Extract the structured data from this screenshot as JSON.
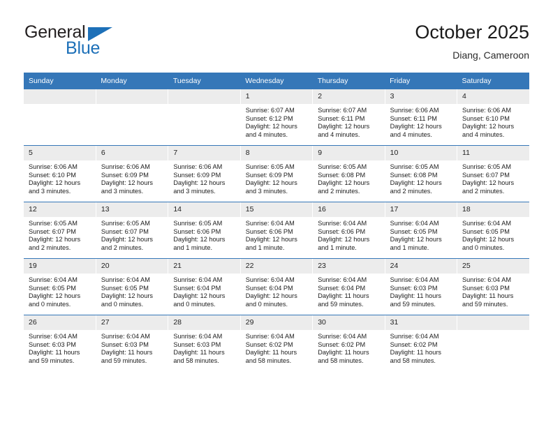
{
  "brand": {
    "name_top": "General",
    "name_bottom": "Blue",
    "triangle_color": "#1d70b8",
    "text_color": "#231f20"
  },
  "header": {
    "title": "October 2025",
    "subtitle": "Diang, Cameroon"
  },
  "theme": {
    "header_bg": "#3577b8",
    "daynum_bg": "#ececec",
    "grid_line": "#3577b8",
    "page_bg": "#ffffff"
  },
  "weekdays": [
    "Sunday",
    "Monday",
    "Tuesday",
    "Wednesday",
    "Thursday",
    "Friday",
    "Saturday"
  ],
  "weeks": [
    [
      {
        "day": "",
        "lines": []
      },
      {
        "day": "",
        "lines": []
      },
      {
        "day": "",
        "lines": []
      },
      {
        "day": "1",
        "lines": [
          "Sunrise: 6:07 AM",
          "Sunset: 6:12 PM",
          "Daylight: 12 hours",
          "and 4 minutes."
        ]
      },
      {
        "day": "2",
        "lines": [
          "Sunrise: 6:07 AM",
          "Sunset: 6:11 PM",
          "Daylight: 12 hours",
          "and 4 minutes."
        ]
      },
      {
        "day": "3",
        "lines": [
          "Sunrise: 6:06 AM",
          "Sunset: 6:11 PM",
          "Daylight: 12 hours",
          "and 4 minutes."
        ]
      },
      {
        "day": "4",
        "lines": [
          "Sunrise: 6:06 AM",
          "Sunset: 6:10 PM",
          "Daylight: 12 hours",
          "and 4 minutes."
        ]
      }
    ],
    [
      {
        "day": "5",
        "lines": [
          "Sunrise: 6:06 AM",
          "Sunset: 6:10 PM",
          "Daylight: 12 hours",
          "and 3 minutes."
        ]
      },
      {
        "day": "6",
        "lines": [
          "Sunrise: 6:06 AM",
          "Sunset: 6:09 PM",
          "Daylight: 12 hours",
          "and 3 minutes."
        ]
      },
      {
        "day": "7",
        "lines": [
          "Sunrise: 6:06 AM",
          "Sunset: 6:09 PM",
          "Daylight: 12 hours",
          "and 3 minutes."
        ]
      },
      {
        "day": "8",
        "lines": [
          "Sunrise: 6:05 AM",
          "Sunset: 6:09 PM",
          "Daylight: 12 hours",
          "and 3 minutes."
        ]
      },
      {
        "day": "9",
        "lines": [
          "Sunrise: 6:05 AM",
          "Sunset: 6:08 PM",
          "Daylight: 12 hours",
          "and 2 minutes."
        ]
      },
      {
        "day": "10",
        "lines": [
          "Sunrise: 6:05 AM",
          "Sunset: 6:08 PM",
          "Daylight: 12 hours",
          "and 2 minutes."
        ]
      },
      {
        "day": "11",
        "lines": [
          "Sunrise: 6:05 AM",
          "Sunset: 6:07 PM",
          "Daylight: 12 hours",
          "and 2 minutes."
        ]
      }
    ],
    [
      {
        "day": "12",
        "lines": [
          "Sunrise: 6:05 AM",
          "Sunset: 6:07 PM",
          "Daylight: 12 hours",
          "and 2 minutes."
        ]
      },
      {
        "day": "13",
        "lines": [
          "Sunrise: 6:05 AM",
          "Sunset: 6:07 PM",
          "Daylight: 12 hours",
          "and 2 minutes."
        ]
      },
      {
        "day": "14",
        "lines": [
          "Sunrise: 6:05 AM",
          "Sunset: 6:06 PM",
          "Daylight: 12 hours",
          "and 1 minute."
        ]
      },
      {
        "day": "15",
        "lines": [
          "Sunrise: 6:04 AM",
          "Sunset: 6:06 PM",
          "Daylight: 12 hours",
          "and 1 minute."
        ]
      },
      {
        "day": "16",
        "lines": [
          "Sunrise: 6:04 AM",
          "Sunset: 6:06 PM",
          "Daylight: 12 hours",
          "and 1 minute."
        ]
      },
      {
        "day": "17",
        "lines": [
          "Sunrise: 6:04 AM",
          "Sunset: 6:05 PM",
          "Daylight: 12 hours",
          "and 1 minute."
        ]
      },
      {
        "day": "18",
        "lines": [
          "Sunrise: 6:04 AM",
          "Sunset: 6:05 PM",
          "Daylight: 12 hours",
          "and 0 minutes."
        ]
      }
    ],
    [
      {
        "day": "19",
        "lines": [
          "Sunrise: 6:04 AM",
          "Sunset: 6:05 PM",
          "Daylight: 12 hours",
          "and 0 minutes."
        ]
      },
      {
        "day": "20",
        "lines": [
          "Sunrise: 6:04 AM",
          "Sunset: 6:05 PM",
          "Daylight: 12 hours",
          "and 0 minutes."
        ]
      },
      {
        "day": "21",
        "lines": [
          "Sunrise: 6:04 AM",
          "Sunset: 6:04 PM",
          "Daylight: 12 hours",
          "and 0 minutes."
        ]
      },
      {
        "day": "22",
        "lines": [
          "Sunrise: 6:04 AM",
          "Sunset: 6:04 PM",
          "Daylight: 12 hours",
          "and 0 minutes."
        ]
      },
      {
        "day": "23",
        "lines": [
          "Sunrise: 6:04 AM",
          "Sunset: 6:04 PM",
          "Daylight: 11 hours",
          "and 59 minutes."
        ]
      },
      {
        "day": "24",
        "lines": [
          "Sunrise: 6:04 AM",
          "Sunset: 6:03 PM",
          "Daylight: 11 hours",
          "and 59 minutes."
        ]
      },
      {
        "day": "25",
        "lines": [
          "Sunrise: 6:04 AM",
          "Sunset: 6:03 PM",
          "Daylight: 11 hours",
          "and 59 minutes."
        ]
      }
    ],
    [
      {
        "day": "26",
        "lines": [
          "Sunrise: 6:04 AM",
          "Sunset: 6:03 PM",
          "Daylight: 11 hours",
          "and 59 minutes."
        ]
      },
      {
        "day": "27",
        "lines": [
          "Sunrise: 6:04 AM",
          "Sunset: 6:03 PM",
          "Daylight: 11 hours",
          "and 59 minutes."
        ]
      },
      {
        "day": "28",
        "lines": [
          "Sunrise: 6:04 AM",
          "Sunset: 6:03 PM",
          "Daylight: 11 hours",
          "and 58 minutes."
        ]
      },
      {
        "day": "29",
        "lines": [
          "Sunrise: 6:04 AM",
          "Sunset: 6:02 PM",
          "Daylight: 11 hours",
          "and 58 minutes."
        ]
      },
      {
        "day": "30",
        "lines": [
          "Sunrise: 6:04 AM",
          "Sunset: 6:02 PM",
          "Daylight: 11 hours",
          "and 58 minutes."
        ]
      },
      {
        "day": "31",
        "lines": [
          "Sunrise: 6:04 AM",
          "Sunset: 6:02 PM",
          "Daylight: 11 hours",
          "and 58 minutes."
        ]
      },
      {
        "day": "",
        "lines": []
      }
    ]
  ]
}
